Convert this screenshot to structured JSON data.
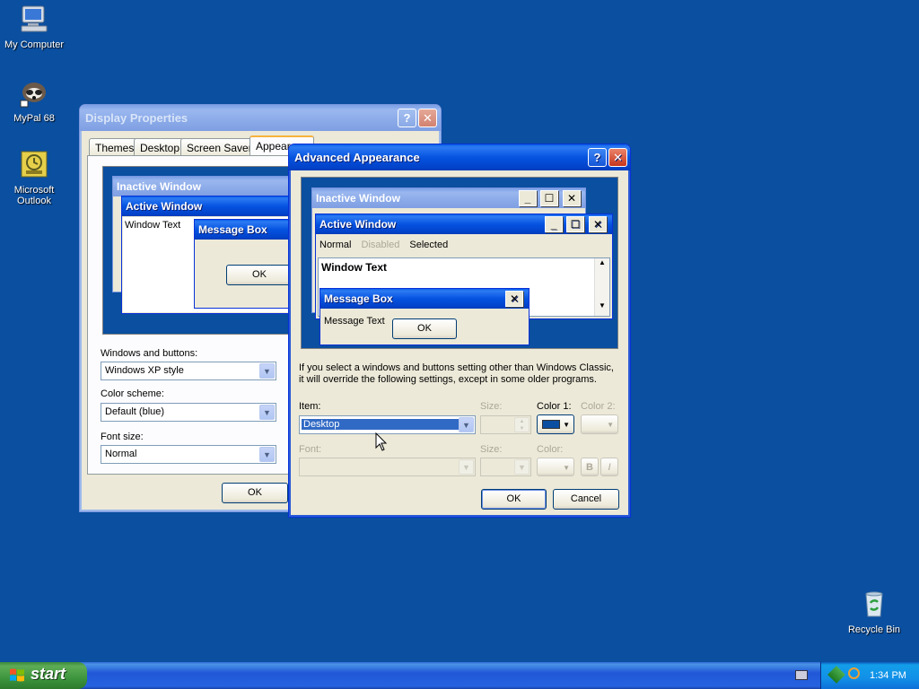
{
  "desktop": {
    "icons": [
      {
        "label": "My Computer",
        "icon": "computer-icon"
      },
      {
        "label": "MyPal 68",
        "icon": "mypal-icon"
      },
      {
        "label": "Microsoft Outlook",
        "icon": "outlook-icon"
      },
      {
        "label": "Recycle Bin",
        "icon": "recycle-bin-icon"
      }
    ]
  },
  "display_properties": {
    "title": "Display Properties",
    "tabs": [
      "Themes",
      "Desktop",
      "Screen Saver",
      "Appeara"
    ],
    "selected_tab": "Appeara",
    "preview": {
      "inactive_title": "Inactive Window",
      "active_title": "Active Window",
      "window_text": "Window Text",
      "message_box_title": "Message Box",
      "ok_label": "OK"
    },
    "windows_buttons_label": "Windows and buttons:",
    "windows_buttons_value": "Windows XP style",
    "color_scheme_label": "Color scheme:",
    "color_scheme_value": "Default (blue)",
    "font_size_label": "Font size:",
    "font_size_value": "Normal",
    "ok_label": "OK"
  },
  "advanced_appearance": {
    "title": "Advanced Appearance",
    "help_label": "?",
    "close_label": "✕",
    "preview": {
      "inactive_title": "Inactive Window",
      "active_title": "Active Window",
      "menu": [
        "Normal",
        "Disabled",
        "Selected"
      ],
      "window_text": "Window Text",
      "message_box_title": "Message Box",
      "message_text": "Message Text",
      "ok_label": "OK"
    },
    "notice": "If you select a windows and buttons setting other than Windows Classic, it will override the following settings, except in some older programs.",
    "item_label": "Item:",
    "item_value": "Desktop",
    "size_label": "Size:",
    "color1_label": "Color 1:",
    "color1_value": "#0a4fa0",
    "color2_label": "Color 2:",
    "font_label": "Font:",
    "font_size_label": "Size:",
    "font_color_label": "Color:",
    "bold_label": "B",
    "italic_label": "I",
    "ok_label": "OK",
    "cancel_label": "Cancel"
  },
  "taskbar": {
    "start_label": "start",
    "clock": "1:34 PM"
  }
}
